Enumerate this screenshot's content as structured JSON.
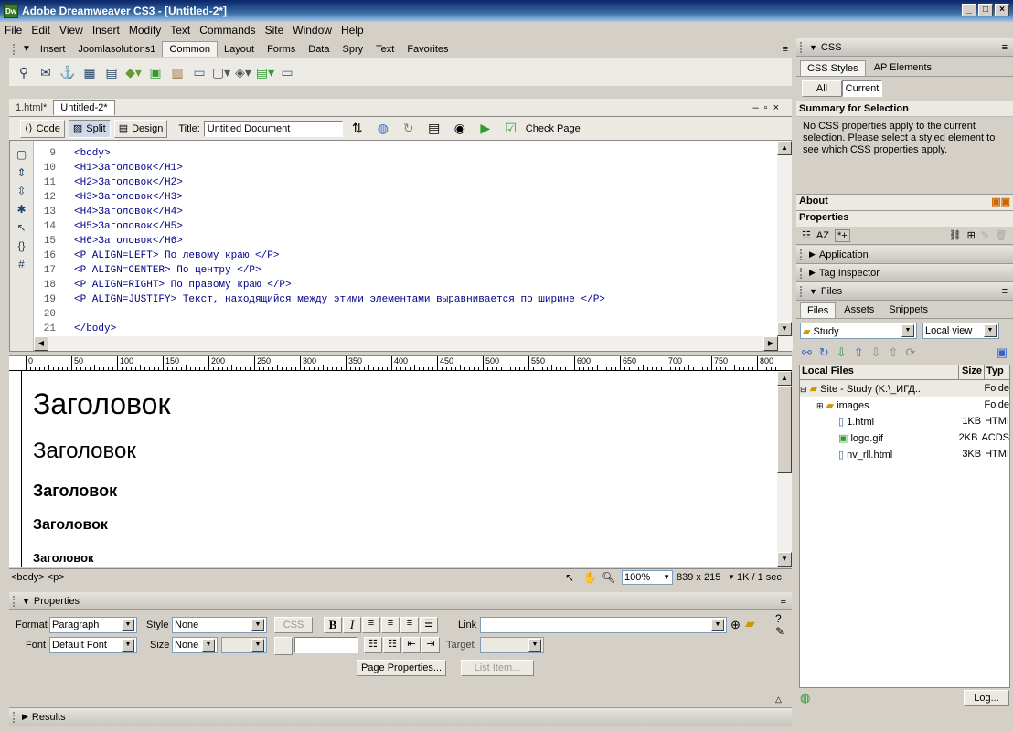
{
  "window": {
    "title": "Adobe Dreamweaver CS3 - [Untitled-2*]",
    "logo": "Dw"
  },
  "menu": [
    "File",
    "Edit",
    "View",
    "Insert",
    "Modify",
    "Text",
    "Commands",
    "Site",
    "Window",
    "Help"
  ],
  "insert_bar": {
    "label": "Insert",
    "tabs": [
      "Joomlasolutions1",
      "Common",
      "Layout",
      "Forms",
      "Data",
      "Spry",
      "Text",
      "Favorites"
    ],
    "active": "Common"
  },
  "doc_tabs": [
    "1.html*",
    "Untitled-2*"
  ],
  "doc_toolbar": {
    "code": "Code",
    "split": "Split",
    "design": "Design",
    "title_label": "Title:",
    "title_value": "Untitled Document",
    "check_page": "Check Page"
  },
  "code_lines": [
    {
      "n": "9",
      "t": "<body>"
    },
    {
      "n": "10",
      "t": "<H1>Заголовок</H1>"
    },
    {
      "n": "11",
      "t": "<H2>Заголовок</H2>"
    },
    {
      "n": "12",
      "t": "<H3>Заголовок</H3>"
    },
    {
      "n": "13",
      "t": "<H4>Заголовок</H4>"
    },
    {
      "n": "14",
      "t": "<H5>Заголовок</H5>"
    },
    {
      "n": "15",
      "t": "<H6>Заголовок</H6>"
    },
    {
      "n": "16",
      "t": "<P ALIGN=LEFT> По левому краю </P>"
    },
    {
      "n": "17",
      "t": "<P ALIGN=CENTER> По центру </P>"
    },
    {
      "n": "18",
      "t": "<P ALIGN=RIGHT> По правому краю </P>"
    },
    {
      "n": "19",
      "t": "<P ALIGN=JUSTIFY> Текст, находящийся между этими элементами выравнивается по ширине </P>"
    },
    {
      "n": "20",
      "t": ""
    },
    {
      "n": "21",
      "t": "</body>"
    }
  ],
  "ruler": [
    "0",
    "50",
    "100",
    "150",
    "200",
    "250",
    "300",
    "350",
    "400",
    "450",
    "500",
    "550",
    "600",
    "650",
    "700",
    "750",
    "800"
  ],
  "design_headings": [
    "Заголовок",
    "Заголовок",
    "Заголовок",
    "Заголовок",
    "Заголовок"
  ],
  "status": {
    "tags": "<body> <p>",
    "zoom": "100%",
    "size": "839 x 215",
    "speed": "1K / 1 sec"
  },
  "properties": {
    "title": "Properties",
    "format_label": "Format",
    "format": "Paragraph",
    "style_label": "Style",
    "style": "None",
    "css": "CSS",
    "link_label": "Link",
    "font_label": "Font",
    "font": "Default Font",
    "size_label": "Size",
    "size": "None",
    "target_label": "Target",
    "page_props": "Page Properties...",
    "list_item": "List Item..."
  },
  "results": "Results",
  "css_panel": {
    "title": "CSS",
    "tabs": [
      "CSS Styles",
      "AP Elements"
    ],
    "modes": [
      "All",
      "Current"
    ],
    "summary_title": "Summary for Selection",
    "summary_text": "No CSS properties apply to the current selection.  Please select a styled element to see which CSS properties apply.",
    "about": "About",
    "properties": "Properties"
  },
  "collapsed_panels": [
    "Application",
    "Tag Inspector"
  ],
  "files_panel": {
    "title": "Files",
    "tabs": [
      "Files",
      "Assets",
      "Snippets"
    ],
    "site": "Study",
    "view": "Local view",
    "col_local": "Local Files",
    "col_size": "Size",
    "col_type": "Typ",
    "rows": [
      {
        "name": "Site - Study (K:\\_ИГД...",
        "size": "",
        "type": "Folde"
      },
      {
        "name": "images",
        "size": "",
        "type": "Folde"
      },
      {
        "name": "1.html",
        "size": "1KB",
        "type": "HTMI"
      },
      {
        "name": "logo.gif",
        "size": "2KB",
        "type": "ACDS"
      },
      {
        "name": "nv_rll.html",
        "size": "3KB",
        "type": "HTMI"
      }
    ],
    "log": "Log..."
  }
}
